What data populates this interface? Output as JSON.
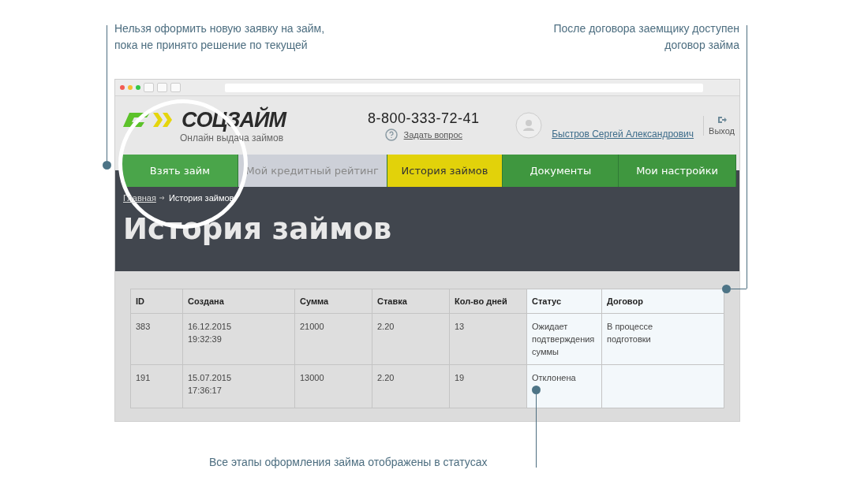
{
  "annotations": [
    {
      "kind": "top-left",
      "text": "Нельзя оформить новую заявку на займ,\nпока не принято решение по текущей"
    },
    {
      "kind": "top-right",
      "text": "После договора заемщику доступен\nдоговор займа"
    },
    {
      "kind": "bottom",
      "text": "Все этапы оформления займа отображены в статусах"
    }
  ],
  "header": {
    "logo": "СОЦЗАЙМ",
    "tagline": "Онлайн выдача займов",
    "phone": "8-800-333-72-41",
    "ask_link": "Задать вопрос",
    "user_name": "Быстров Сергей Александрович",
    "logout": "Выход"
  },
  "nav": [
    {
      "label": "Взять займ",
      "kind": "action",
      "selected": false
    },
    {
      "label": "Мой кредитный рейтинг",
      "kind": "muted",
      "selected": false
    },
    {
      "label": "История займов",
      "kind": "plain",
      "selected": true
    },
    {
      "label": "Документы",
      "kind": "plain",
      "selected": false
    },
    {
      "label": "Мои настройки",
      "kind": "plain",
      "selected": false
    }
  ],
  "breadcrumb": {
    "home": "Главная",
    "current": "История займов"
  },
  "page_title": "История займов",
  "table": {
    "columns": [
      {
        "label": "ID",
        "highlighted": false
      },
      {
        "label": "Создана",
        "highlighted": false
      },
      {
        "label": "Сумма",
        "highlighted": false
      },
      {
        "label": "Ставка",
        "highlighted": false
      },
      {
        "label": "Кол-во дней",
        "highlighted": false
      },
      {
        "label": "Статус",
        "highlighted": true
      },
      {
        "label": "Договор",
        "highlighted": true
      }
    ],
    "rows": [
      [
        "383",
        "16.12.2015\n19:32:39",
        "21000",
        "2.20",
        "13",
        "Ожидает\nподтверждения\nсуммы",
        "В процессе\nподготовки"
      ],
      [
        "191",
        "15.07.2015\n17:36:17",
        "13000",
        "2.20",
        "19",
        "Отклонена",
        ""
      ]
    ]
  }
}
